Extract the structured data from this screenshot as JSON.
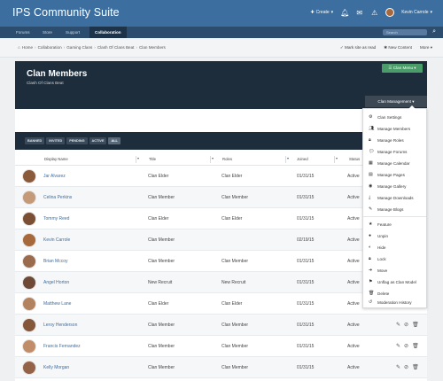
{
  "header": {
    "site_title": "IPS Community Suite",
    "create_label": "Create",
    "user_name": "Kevin Carrole"
  },
  "nav": {
    "tabs": [
      "Forums",
      "Store",
      "Support",
      "Collaboration"
    ],
    "active_tab": "Collaboration",
    "search_placeholder": "Search"
  },
  "breadcrumb": {
    "items": [
      "Home",
      "Collaboration",
      "Gaming Clans",
      "Clash Of Clans Beat",
      "Clan Members"
    ]
  },
  "page_actions": {
    "mark_read": "Mark site as read",
    "new_content": "New Content",
    "more": "More"
  },
  "clan": {
    "title": "Clan Members",
    "subtitle": "Clash Of Clans Beat",
    "menu_button": "Clan Menu",
    "management_button": "Clan Management"
  },
  "filters": {
    "tabs": [
      "BANNED",
      "INVITED",
      "PENDING",
      "ACTIVE",
      "ALL"
    ],
    "active": "ALL"
  },
  "table": {
    "headers": {
      "display_name": "Display Name",
      "title": "Title",
      "roles": "Roles",
      "joined": "Joined",
      "status": "Status"
    },
    "rows": [
      {
        "name": "Jar Alvarez",
        "title": "Clan Elder",
        "role": "Clan Elder",
        "joined": "01/31/15",
        "status": "Active"
      },
      {
        "name": "Celina Perkins",
        "title": "Clan Member",
        "role": "Clan Member",
        "joined": "01/31/15",
        "status": "Active"
      },
      {
        "name": "Tommy Reed",
        "title": "Clan Elder",
        "role": "Clan Elder",
        "joined": "01/31/15",
        "status": "Active"
      },
      {
        "name": "Kevin Carrole",
        "title": "Clan Member",
        "role": "",
        "joined": "02/19/15",
        "status": "Active"
      },
      {
        "name": "Brian Mccoy",
        "title": "Clan Member",
        "role": "Clan Member",
        "joined": "01/31/15",
        "status": "Active"
      },
      {
        "name": "Angel Horton",
        "title": "New Recruit",
        "role": "New Recruit",
        "joined": "01/31/15",
        "status": "Active"
      },
      {
        "name": "Matthew Lane",
        "title": "Clan Elder",
        "role": "Clan Elder",
        "joined": "01/31/15",
        "status": "Active"
      },
      {
        "name": "Leroy Henderson",
        "title": "Clan Member",
        "role": "Clan Member",
        "joined": "01/31/15",
        "status": "Active"
      },
      {
        "name": "Francis Fernandez",
        "title": "Clan Member",
        "role": "Clan Member",
        "joined": "01/31/15",
        "status": "Active"
      },
      {
        "name": "Kelly Morgan",
        "title": "Clan Member",
        "role": "Clan Member",
        "joined": "01/31/15",
        "status": "Active"
      }
    ]
  },
  "dropdown": {
    "items": [
      {
        "label": "Clan Settings",
        "icon": "wrench-icon"
      },
      {
        "label": "Manage Members",
        "icon": "users-icon"
      },
      {
        "label": "Manage Roles",
        "icon": "lock-icon"
      },
      {
        "label": "Manage Forums",
        "icon": "comments-icon"
      },
      {
        "label": "Manage Calendar",
        "icon": "calendar-icon"
      },
      {
        "label": "Manage Pages",
        "icon": "file-icon"
      },
      {
        "label": "Manage Gallery",
        "icon": "camera-icon"
      },
      {
        "label": "Manage Downloads",
        "icon": "download-icon"
      },
      {
        "label": "Manage Blogs",
        "icon": "pencil-icon"
      },
      {
        "label": "Feature",
        "icon": "star-icon"
      },
      {
        "label": "Unpin",
        "icon": "pin-icon"
      },
      {
        "label": "Hide",
        "icon": "eye-slash-icon"
      },
      {
        "label": "Lock",
        "icon": "lock-icon"
      },
      {
        "label": "Move",
        "icon": "arrow-icon"
      },
      {
        "label": "Unflag as Clan Model",
        "icon": "flag-icon"
      },
      {
        "label": "Delete",
        "icon": "trash-icon"
      },
      {
        "label": "Moderation History",
        "icon": "history-icon"
      }
    ]
  },
  "colors": {
    "header_bg": "#3c6e9f",
    "nav_bg": "#2c4d6e",
    "clan_header_bg": "#1d2d3c",
    "clan_menu_green": "#4a9c68",
    "link_blue": "#3a6ea5"
  }
}
